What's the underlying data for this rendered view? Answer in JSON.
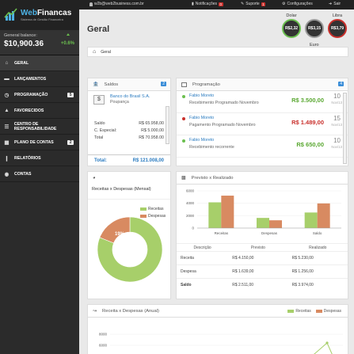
{
  "topbar": {
    "user": "w2b@web2business.com.br",
    "notifications_label": "Notificações",
    "notifications_count": "0",
    "support_label": "Suporte",
    "support_count": "1",
    "settings_label": "Configurações",
    "logout_label": "Sair"
  },
  "brand": {
    "name_a": "Web",
    "name_b": "Financas",
    "tagline": "Sistema de Gestão Financeira"
  },
  "balance": {
    "label": "General balance:",
    "value": "$10,900.36",
    "change": "+0.6%"
  },
  "nav": [
    {
      "label": "GERAL",
      "icon": "home-icon",
      "count": ""
    },
    {
      "label": "LANÇAMENTOS",
      "icon": "money-icon",
      "count": ""
    },
    {
      "label": "PROGRAMAÇÃO",
      "icon": "clock-icon",
      "count": "5"
    },
    {
      "label": "FAVORECIDOS",
      "icon": "user-icon",
      "count": ""
    },
    {
      "label": "CENTRO DE RESPONSABILIDADE",
      "icon": "list-icon",
      "count": ""
    },
    {
      "label": "PLANO DE CONTAS",
      "icon": "grid-icon",
      "count": "2"
    },
    {
      "label": "RELATÓRIOS",
      "icon": "chart-icon",
      "count": ""
    },
    {
      "label": "CONTAS",
      "icon": "users-icon",
      "count": ""
    }
  ],
  "page_title": "Geral",
  "currencies": [
    {
      "label": "Dolar",
      "value": "R$2,32"
    },
    {
      "label": "Euro",
      "value": "R$3,15"
    },
    {
      "label": "Libra",
      "value": "R$3,79"
    }
  ],
  "breadcrumb": "Geral",
  "saldos": {
    "title": "Saldos",
    "count": "2",
    "bank_name": "Banco do Brasil S.A.",
    "account_type": "Poupança",
    "rows": [
      {
        "label": "Saldo",
        "value": "R$ 65.958,00"
      },
      {
        "label": "C. Especial:",
        "value": "R$ 5.000,00"
      },
      {
        "label": "Total",
        "value": "R$ 70.958,00"
      }
    ],
    "total_label": "Total:",
    "total_value": "R$ 121.008,00"
  },
  "programacao": {
    "title": "Programação",
    "count": "4",
    "items": [
      {
        "name": "Fabio Moreto",
        "desc": "Recebimento Programado Novembro",
        "amount": "R$ 3.500,00",
        "day": "10",
        "month": "Nov/13",
        "color": "#6bbf4f"
      },
      {
        "name": "Fabio Moreto",
        "desc": "Pagamento Programado Novembro",
        "amount": "R$ 1.489,00",
        "day": "15",
        "month": "Nov/13",
        "color": "#c9302c"
      },
      {
        "name": "Fabio Moreto",
        "desc": "Recebimento recorrente",
        "amount": "R$ 650,00",
        "day": "10",
        "month": "Nov/13",
        "color": "#6bbf4f"
      }
    ]
  },
  "pie": {
    "title": "Receitas x Despesas (Mensal)",
    "legend": [
      "Receitas",
      "Despesas"
    ],
    "pct_receitas": "81%",
    "pct_despesas": "19%"
  },
  "previsto": {
    "title": "Previsto x Realizado",
    "table_headers": [
      "Descrição",
      "Previsto",
      "Realizado"
    ],
    "table_rows": [
      [
        "Receita",
        "R$ 4.150,00",
        "R$ 5.230,00"
      ],
      [
        "Despesa",
        "R$ 1.639,00",
        "R$ 1.256,00"
      ],
      [
        "Saldo",
        "R$ 2.511,00",
        "R$ 3.974,00"
      ]
    ]
  },
  "anual": {
    "title": "Receita x Despesas (Anual)",
    "legend": [
      "Receitas",
      "Despesas"
    ]
  },
  "colors": {
    "green": "#a7cf6a",
    "orange": "#d88a61",
    "red": "#c9302c",
    "blue": "#3b8ed8"
  },
  "chart_data": [
    {
      "type": "pie",
      "title": "Receitas x Despesas (Mensal)",
      "labels": [
        "Receitas",
        "Despesas"
      ],
      "values": [
        81,
        19
      ]
    },
    {
      "type": "bar",
      "title": "Previsto x Realizado",
      "categories": [
        "Receitas",
        "Despesas",
        "Saldo"
      ],
      "series": [
        {
          "name": "Previsto",
          "values": [
            4150,
            1639,
            2511
          ]
        },
        {
          "name": "Realizado",
          "values": [
            5230,
            1256,
            3974
          ]
        }
      ],
      "yticks": [
        "0",
        "2000",
        "4000",
        "6000"
      ],
      "ylim": [
        0,
        6000
      ]
    },
    {
      "type": "line",
      "title": "Receita x Despesas (Anual)",
      "yticks": [
        "4000",
        "6000",
        "8000"
      ],
      "series": [
        {
          "name": "Receitas"
        },
        {
          "name": "Despesas"
        }
      ]
    }
  ]
}
